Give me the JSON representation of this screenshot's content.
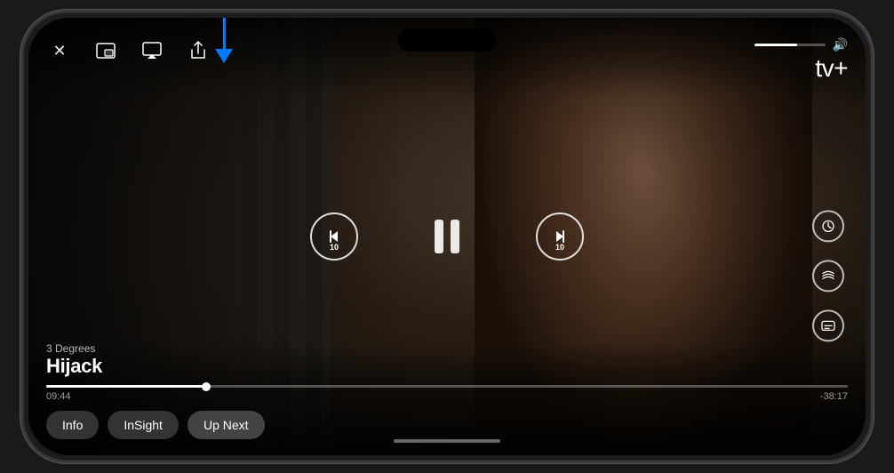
{
  "phone": {
    "screen": {
      "video": {
        "show_season": "3 Degrees",
        "show_title": "Hijack",
        "time_elapsed": "09:44",
        "time_remaining": "-38:17",
        "progress_percent": 20,
        "volume_percent": 60
      },
      "top_controls": {
        "close_label": "✕",
        "pip_label": "⊡",
        "airplay_label": "⬛",
        "share_label": "⬆"
      },
      "appletv": {
        "logo_text": "tv+",
        "apple_symbol": ""
      },
      "playback": {
        "skip_back_seconds": "10",
        "skip_forward_seconds": "10"
      },
      "side_controls": {
        "speed_icon": "⚡",
        "audio_icon": "〰",
        "subtitles_icon": "💬"
      },
      "bottom_tabs": [
        {
          "id": "info",
          "label": "Info"
        },
        {
          "id": "insight",
          "label": "InSight"
        },
        {
          "id": "upnext",
          "label": "Up Next"
        }
      ],
      "arrow_indicator": {
        "color": "#007AFF",
        "pointing_to": "airplay-button"
      }
    }
  }
}
